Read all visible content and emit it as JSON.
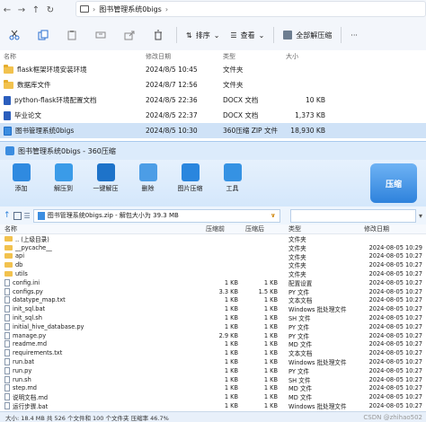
{
  "explorer": {
    "breadcrumb": {
      "root": "›",
      "folder": "图书管理系统0bigs",
      "end": "›"
    },
    "toolbar": {
      "sort": "排序",
      "view": "查看",
      "extract_all": "全部解压缩",
      "more": "···"
    },
    "columns": {
      "name": "名称",
      "date": "修改日期",
      "type": "类型",
      "size": "大小"
    },
    "files": [
      {
        "name": "flask框架环境安装环境",
        "date": "2024/8/5 10:45",
        "type": "文件夹",
        "size": "",
        "kind": "folder",
        "selected": false
      },
      {
        "name": "数据库文件",
        "date": "2024/8/7 12:56",
        "type": "文件夹",
        "size": "",
        "kind": "folder",
        "selected": false
      },
      {
        "name": "python-flask环境配置文档",
        "date": "2024/8/5 22:36",
        "type": "DOCX 文档",
        "size": "10 KB",
        "kind": "doc",
        "selected": false
      },
      {
        "name": "毕业论文",
        "date": "2024/8/5 22:37",
        "type": "DOCX 文档",
        "size": "1,373 KB",
        "kind": "doc",
        "selected": false
      },
      {
        "name": "图书管理系统0bigs",
        "date": "2024/8/5 10:30",
        "type": "360压缩 ZIP 文件",
        "size": "18,930 KB",
        "kind": "zip",
        "selected": true
      }
    ]
  },
  "zip": {
    "title": "图书管理系统0bigs - 360压缩",
    "buttons": [
      "添加",
      "解压到",
      "一键解压",
      "删除",
      "图片压缩",
      "工具"
    ],
    "logo": "压缩",
    "path": "图书管理系统0bigs.zip - 解包大小为 39.3 MB",
    "path_dropdown": "∨",
    "columns": {
      "name": "名称",
      "size": "压缩前",
      "csize": "压缩后",
      "type": "类型",
      "mod": "修改日期"
    },
    "rows": [
      {
        "name": ".. (上级目录)",
        "size": "",
        "csize": "",
        "type": "文件夹",
        "mod": "",
        "kind": "folder"
      },
      {
        "name": "__pycache__",
        "size": "",
        "csize": "",
        "type": "文件夹",
        "mod": "2024-08-05 10:29",
        "kind": "folder"
      },
      {
        "name": "api",
        "size": "",
        "csize": "",
        "type": "文件夹",
        "mod": "2024-08-05 10:27",
        "kind": "folder"
      },
      {
        "name": "db",
        "size": "",
        "csize": "",
        "type": "文件夹",
        "mod": "2024-08-05 10:27",
        "kind": "folder"
      },
      {
        "name": "utils",
        "size": "",
        "csize": "",
        "type": "文件夹",
        "mod": "2024-08-05 10:27",
        "kind": "folder"
      },
      {
        "name": "config.ini",
        "size": "1 KB",
        "csize": "1 KB",
        "type": "配置设置",
        "mod": "2024-08-05 10:27",
        "kind": "file"
      },
      {
        "name": "configs.py",
        "size": "3.3 KB",
        "csize": "1.5 KB",
        "type": "PY 文件",
        "mod": "2024-08-05 10:27",
        "kind": "file"
      },
      {
        "name": "datatype_map.txt",
        "size": "1 KB",
        "csize": "1 KB",
        "type": "文本文档",
        "mod": "2024-08-05 10:27",
        "kind": "file"
      },
      {
        "name": "init_sql.bat",
        "size": "1 KB",
        "csize": "1 KB",
        "type": "Windows 批处理文件",
        "mod": "2024-08-05 10:27",
        "kind": "file"
      },
      {
        "name": "init_sql.sh",
        "size": "1 KB",
        "csize": "1 KB",
        "type": "SH 文件",
        "mod": "2024-08-05 10:27",
        "kind": "file"
      },
      {
        "name": "initial_hive_database.py",
        "size": "1 KB",
        "csize": "1 KB",
        "type": "PY 文件",
        "mod": "2024-08-05 10:27",
        "kind": "file"
      },
      {
        "name": "manage.py",
        "size": "2.9 KB",
        "csize": "1 KB",
        "type": "PY 文件",
        "mod": "2024-08-05 10:27",
        "kind": "file"
      },
      {
        "name": "readme.md",
        "size": "1 KB",
        "csize": "1 KB",
        "type": "MD 文件",
        "mod": "2024-08-05 10:27",
        "kind": "file"
      },
      {
        "name": "requirements.txt",
        "size": "1 KB",
        "csize": "1 KB",
        "type": "文本文档",
        "mod": "2024-08-05 10:27",
        "kind": "file"
      },
      {
        "name": "run.bat",
        "size": "1 KB",
        "csize": "1 KB",
        "type": "Windows 批处理文件",
        "mod": "2024-08-05 10:27",
        "kind": "file"
      },
      {
        "name": "run.py",
        "size": "1 KB",
        "csize": "1 KB",
        "type": "PY 文件",
        "mod": "2024-08-05 10:27",
        "kind": "file"
      },
      {
        "name": "run.sh",
        "size": "1 KB",
        "csize": "1 KB",
        "type": "SH 文件",
        "mod": "2024-08-05 10:27",
        "kind": "file"
      },
      {
        "name": "step.md",
        "size": "1 KB",
        "csize": "1 KB",
        "type": "MD 文件",
        "mod": "2024-08-05 10:27",
        "kind": "file"
      },
      {
        "name": "说明文档.md",
        "size": "1 KB",
        "csize": "1 KB",
        "type": "MD 文件",
        "mod": "2024-08-05 10:27",
        "kind": "file"
      },
      {
        "name": "运行步骤.bat",
        "size": "1 KB",
        "csize": "1 KB",
        "type": "Windows 批处理文件",
        "mod": "2024-08-05 10:27",
        "kind": "file"
      }
    ],
    "status": "大小: 18.4 MB 共 526 个文件和 100 个文件夹 压缩率 46.7%"
  },
  "watermark": "CSDN @zhihao502",
  "colors": {
    "selected_row": "#cfe2f7",
    "zip_title_bar": "#dcebfb",
    "folder": "#f2c24e",
    "accent": "#2e82dc"
  }
}
